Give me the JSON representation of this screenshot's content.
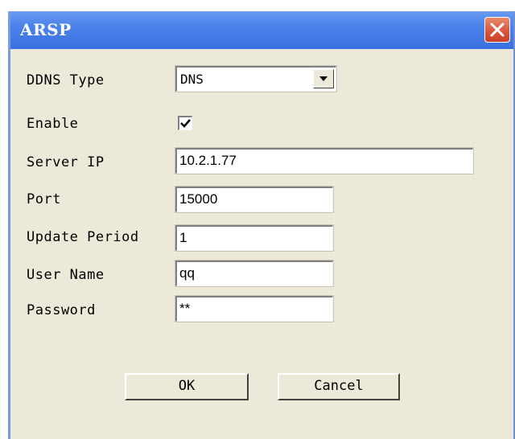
{
  "window": {
    "title": "ARSP"
  },
  "form": {
    "ddns_type_label": "DDNS Type",
    "ddns_type_value": "DNS",
    "enable_label": "Enable",
    "enable_checked": true,
    "server_ip_label": "Server IP",
    "server_ip_value": "10.2.1.77",
    "port_label": "Port",
    "port_value": "15000",
    "update_period_label": "Update Period",
    "update_period_value": "1",
    "user_name_label": "User Name",
    "user_name_value": "qq",
    "password_label": "Password",
    "password_value": "**"
  },
  "buttons": {
    "ok_label": "OK",
    "cancel_label": "Cancel"
  },
  "icons": {
    "close": "close-icon",
    "dropdown": "chevron-down-icon",
    "check": "checkmark-icon"
  },
  "colors": {
    "titlebar": "#3a70e0",
    "close_button": "#d9533a",
    "window_bg": "#ece9d8"
  }
}
